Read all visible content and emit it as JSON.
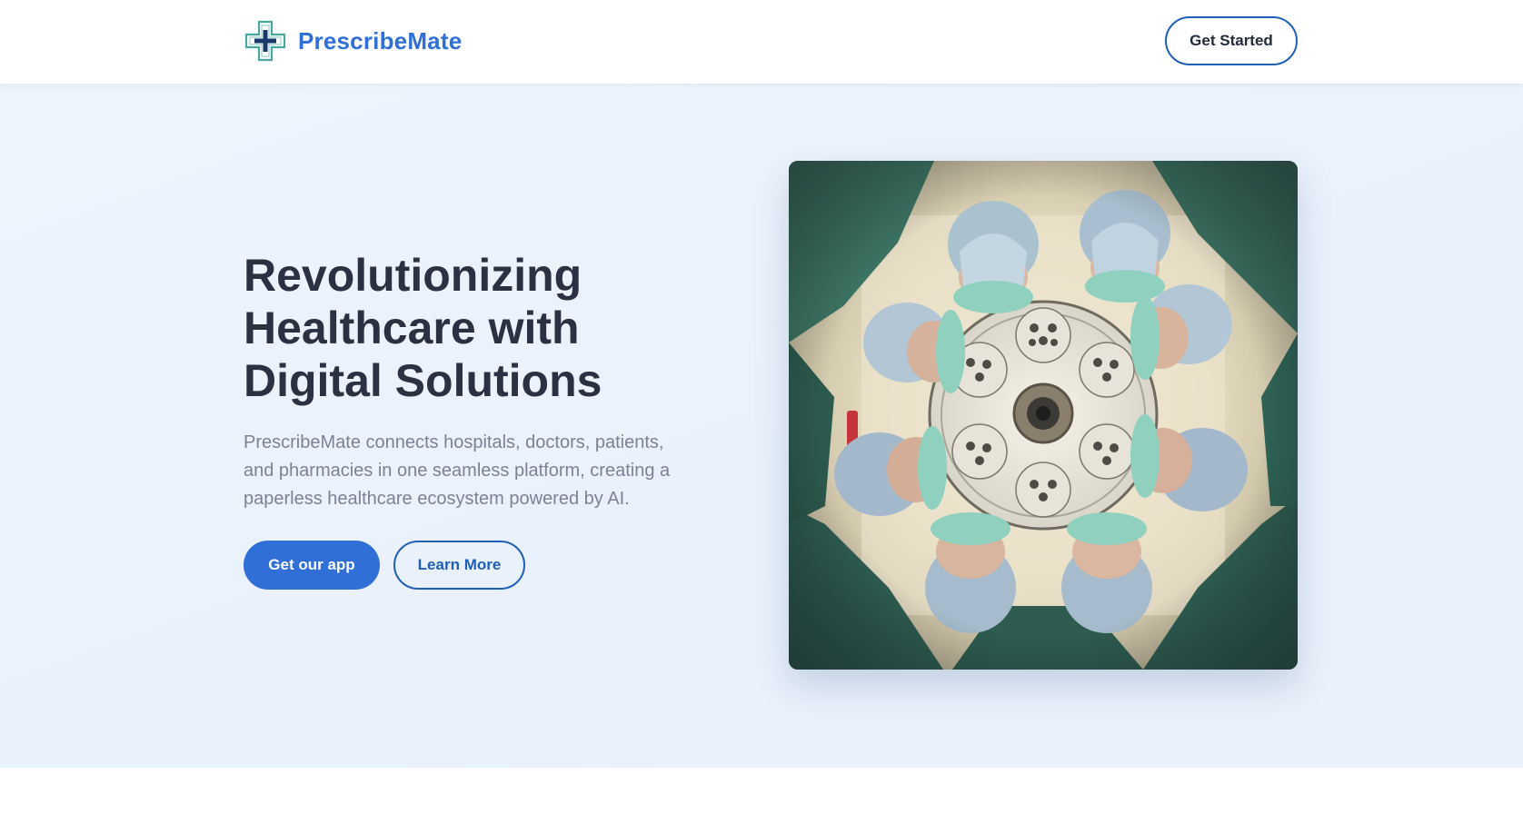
{
  "header": {
    "brand": "PrescribeMate",
    "logo_icon": "medical-cross-icon",
    "cta_label": "Get Started"
  },
  "hero": {
    "title_line1": "Revolutionizing",
    "title_line2": "Healthcare with",
    "title_line3": "Digital Solutions",
    "description": "PrescribeMate connects hospitals, doctors, patients, and pharmacies in one seamless platform, creating a paperless healthcare ecosystem powered by AI.",
    "primary_button": "Get our app",
    "secondary_button": "Learn More"
  },
  "colors": {
    "brand_blue": "#2f6fd6",
    "dark_blue": "#1f5fb8",
    "heading": "#2a3140",
    "body_text": "#7a8394",
    "hero_bg": "#eaf1fb"
  }
}
